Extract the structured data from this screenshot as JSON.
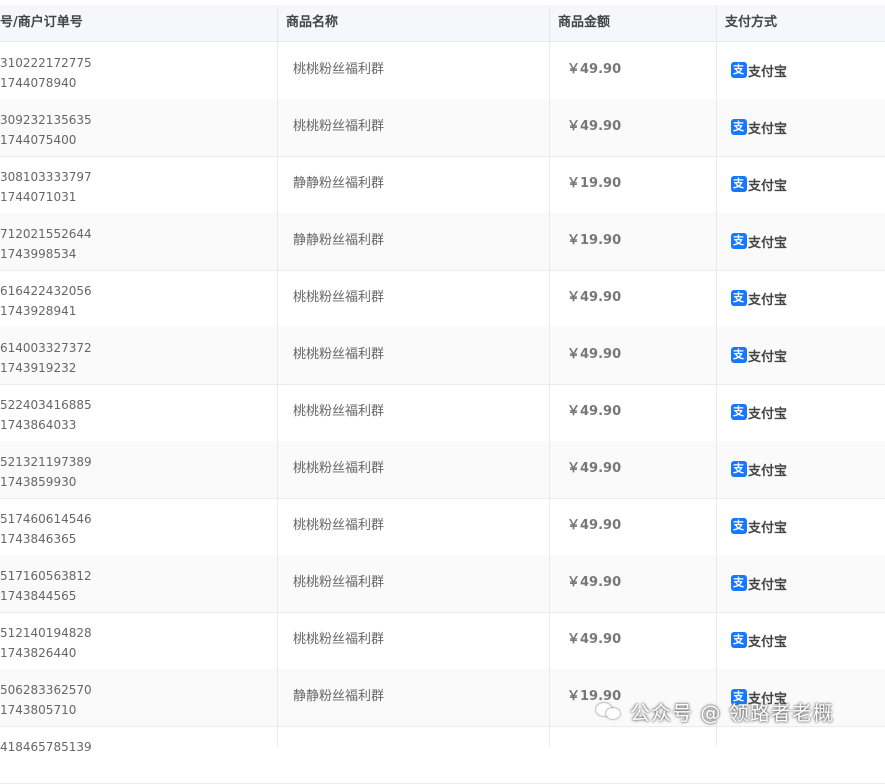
{
  "header": {
    "order_col": "号/商户订单号",
    "product_col": "商品名称",
    "amount_col": "商品金额",
    "pay_col": "支付方式"
  },
  "rows": [
    {
      "order_no": "310222172775",
      "merchant_no": "1744078940",
      "product": "桃桃粉丝福利群",
      "amount": "￥49.90",
      "pay": "支付宝"
    },
    {
      "order_no": "309232135635",
      "merchant_no": "1744075400",
      "product": "桃桃粉丝福利群",
      "amount": "￥49.90",
      "pay": "支付宝"
    },
    {
      "order_no": "308103333797",
      "merchant_no": "1744071031",
      "product": "静静粉丝福利群",
      "amount": "￥19.90",
      "pay": "支付宝"
    },
    {
      "order_no": "712021552644",
      "merchant_no": "1743998534",
      "product": "静静粉丝福利群",
      "amount": "￥19.90",
      "pay": "支付宝"
    },
    {
      "order_no": "616422432056",
      "merchant_no": "1743928941",
      "product": "桃桃粉丝福利群",
      "amount": "￥49.90",
      "pay": "支付宝"
    },
    {
      "order_no": "614003327372",
      "merchant_no": "1743919232",
      "product": "桃桃粉丝福利群",
      "amount": "￥49.90",
      "pay": "支付宝"
    },
    {
      "order_no": "522403416885",
      "merchant_no": "1743864033",
      "product": "桃桃粉丝福利群",
      "amount": "￥49.90",
      "pay": "支付宝"
    },
    {
      "order_no": "521321197389",
      "merchant_no": "1743859930",
      "product": "桃桃粉丝福利群",
      "amount": "￥49.90",
      "pay": "支付宝"
    },
    {
      "order_no": "517460614546",
      "merchant_no": "1743846365",
      "product": "桃桃粉丝福利群",
      "amount": "￥49.90",
      "pay": "支付宝"
    },
    {
      "order_no": "517160563812",
      "merchant_no": "1743844565",
      "product": "桃桃粉丝福利群",
      "amount": "￥49.90",
      "pay": "支付宝"
    },
    {
      "order_no": "512140194828",
      "merchant_no": "1743826440",
      "product": "桃桃粉丝福利群",
      "amount": "￥49.90",
      "pay": "支付宝"
    },
    {
      "order_no": "506283362570",
      "merchant_no": "1743805710",
      "product": "静静粉丝福利群",
      "amount": "￥19.90",
      "pay": "支付宝"
    },
    {
      "order_no": "418465785139",
      "merchant_no": "",
      "product": "",
      "amount": "",
      "pay": ""
    }
  ],
  "watermark": {
    "text": "公众号 @ 领路者老概"
  },
  "icons": {
    "pay_icon": "alipay-icon",
    "watermark_icon": "wechat-icon"
  },
  "colors": {
    "alipay_blue": "#1677ff",
    "header_bg": "#f5f7fa"
  }
}
